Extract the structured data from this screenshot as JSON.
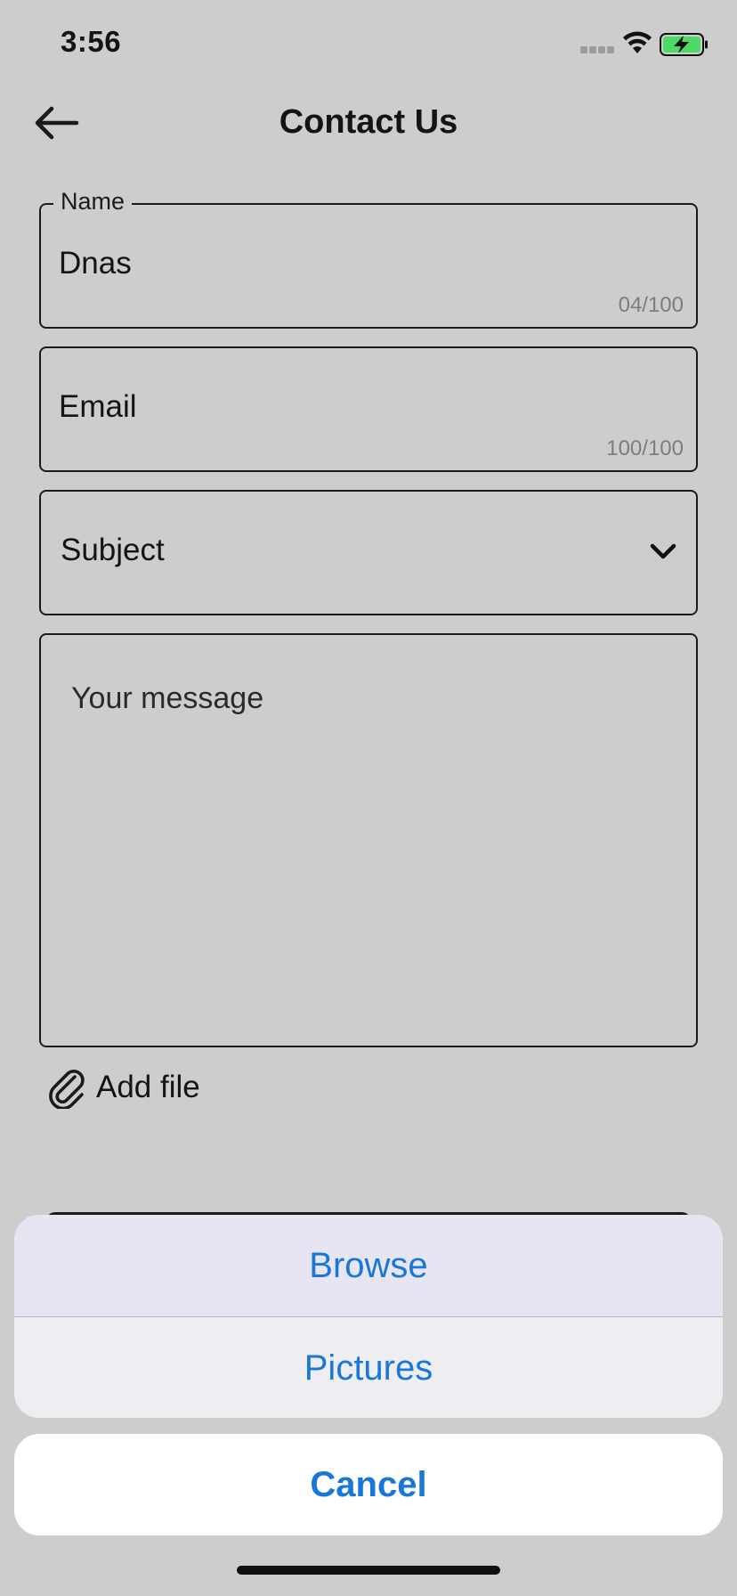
{
  "status_bar": {
    "time": "3:56"
  },
  "header": {
    "title": "Contact Us",
    "back_icon": "arrow-left-icon"
  },
  "form": {
    "name": {
      "label": "Name",
      "value": "Dnas",
      "counter": "04/100"
    },
    "email": {
      "placeholder": "Email",
      "counter": "100/100"
    },
    "subject": {
      "placeholder": "Subject",
      "icon": "chevron-down-icon"
    },
    "message": {
      "placeholder": "Your message"
    },
    "add_file": {
      "label": "Add file",
      "icon": "paperclip-icon"
    }
  },
  "action_sheet": {
    "options": [
      "Browse",
      "Pictures"
    ],
    "cancel": "Cancel",
    "accent_color": "#1877d9"
  },
  "colors": {
    "background": "#cdcdcd",
    "battery_fill": "#4cd964"
  }
}
